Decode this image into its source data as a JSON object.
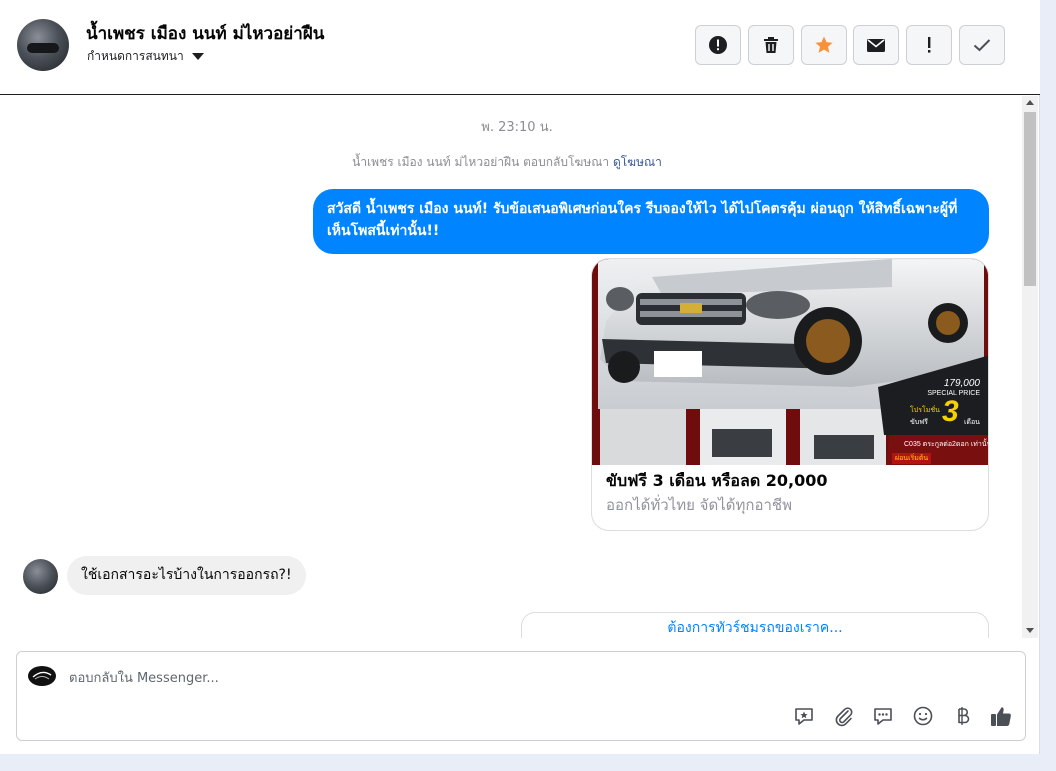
{
  "header": {
    "contact_name": "น้ำเพชร เมือง นนท์ ม่ไหวอย่าฝืน",
    "assign_label": "กำหนดการสนทนา",
    "actions": [
      "alert-icon",
      "trash-icon",
      "star-icon",
      "envelope-icon",
      "exclamation-icon",
      "check-icon"
    ]
  },
  "conversation": {
    "timestamp": "พ. 23:10 น.",
    "ad_reply_text": "น้ำเพชร เมือง นนท์ ม่ไหวอย่าฝืน ตอบกลับโฆษณา",
    "ad_reply_link": "ดูโฆษณา",
    "outgoing_message": "สวัสดี น้ำเพชร เมือง นนท์! รับข้อเสนอพิเศษก่อนใคร รีบจองให้ไว ได้ไปโคตรคุ้ม ผ่อนถูก ให้สิทธิ์เฉพาะผู้ที่เห็นโพสนี้เท่านั้น!!",
    "ad_card": {
      "headline": "ขับฟรี 3 เดือน หรือลด 20,000",
      "description": "ออกได้ทั่วไทย จัดได้ทุกอาชีพ",
      "image_price": "179,000",
      "image_special": "SPECIAL PRICE",
      "image_promo_number": "3",
      "image_promo_left": "โปรโมชั่น",
      "image_promo_free": "ขับฟรี",
      "image_promo_month": "เดือน",
      "image_footer": "C035  ตระกูลต่อ2ดอก เท่านั้น",
      "image_tag": "ผ่อนเริ่มต้น"
    },
    "incoming_message": "ใช้เอกสารอะไรบ้างในการออกรถ?!",
    "quick_reply": "ต้องการทัวร์ชมรถของเราค..."
  },
  "composer": {
    "placeholder": "ตอบกลับใน Messenger...",
    "tools": [
      "saved-reply-icon",
      "attachment-icon",
      "chat-icon",
      "emoji-icon",
      "baht-icon",
      "like-icon"
    ]
  },
  "colors": {
    "accent": "#0084ff",
    "link": "#385898",
    "star": "#f7923a"
  }
}
